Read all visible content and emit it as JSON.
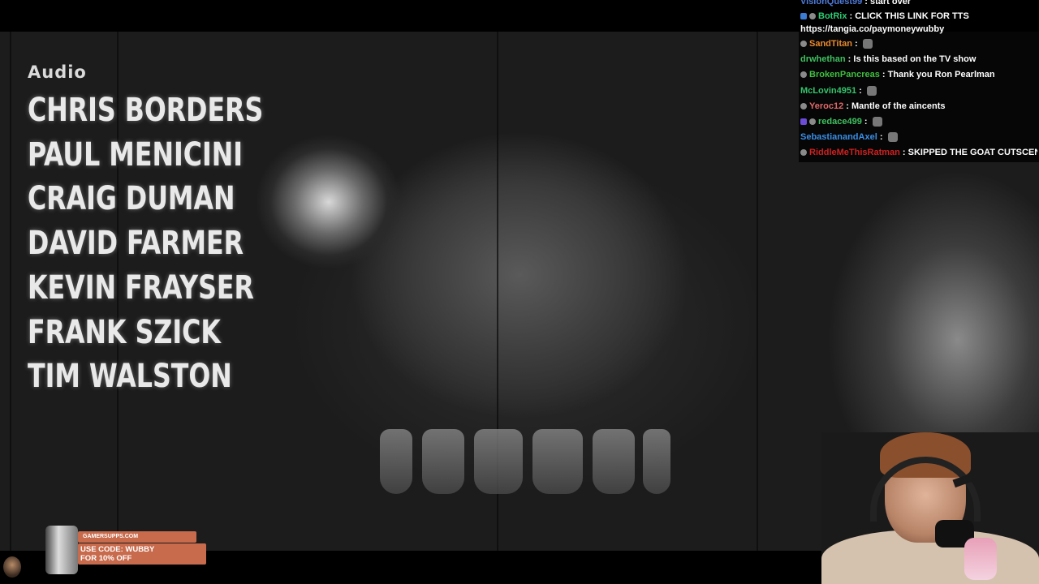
{
  "credits": {
    "heading": "Audio",
    "names": [
      "CHRIS BORDERS",
      "PAUL MENICINI",
      "CRAIG DUMAN",
      "DAVID FARMER",
      "KEVIN FRAYSER",
      "FRANK SZICK",
      "TIM WALSTON"
    ]
  },
  "chat": {
    "messages": [
      {
        "user": "VisionQuest99",
        "color": "#4f7bd9",
        "text": "start over",
        "badges": 0,
        "emote": false
      },
      {
        "user": "BotRix",
        "color": "#2ecc71",
        "text": "CLICK THIS LINK FOR TTS",
        "badges": 2,
        "emote": false
      },
      {
        "user": "",
        "color": "#ffffff",
        "text": "https://tangia.co/paymoneywubby",
        "badges": 0,
        "emote": false
      },
      {
        "user": "SandTitan",
        "color": "#e8892f",
        "text": "",
        "badges": 1,
        "emote": true
      },
      {
        "user": "drwhethan",
        "color": "#40c060",
        "text": "Is this based on the TV show",
        "badges": 0,
        "emote": false
      },
      {
        "user": "BrokenPancreas",
        "color": "#3fbf3f",
        "text": "Thank you Ron Pearlman",
        "badges": 1,
        "emote": false
      },
      {
        "user": "McLovin4951",
        "color": "#36c36b",
        "text": "",
        "badges": 0,
        "emote": true
      },
      {
        "user": "Yeroc12",
        "color": "#e06a6a",
        "text": "Mantle of the aincents",
        "badges": 1,
        "emote": false
      },
      {
        "user": "redace499",
        "color": "#40c060",
        "text": "",
        "badges": 2,
        "emote": true
      },
      {
        "user": "SebastianandAxel",
        "color": "#3a8ee6",
        "text": "",
        "badges": 0,
        "emote": true
      },
      {
        "user": "RiddleMeThisRatman",
        "color": "#d02020",
        "text": "SKIPPED THE GOAT CUTSCENE",
        "badges": 1,
        "emote": false
      }
    ]
  },
  "ad": {
    "domain": "GAMERSUPPS.COM",
    "code_line1": "USE CODE: WUBBY",
    "code_line2": "FOR 10% OFF"
  }
}
